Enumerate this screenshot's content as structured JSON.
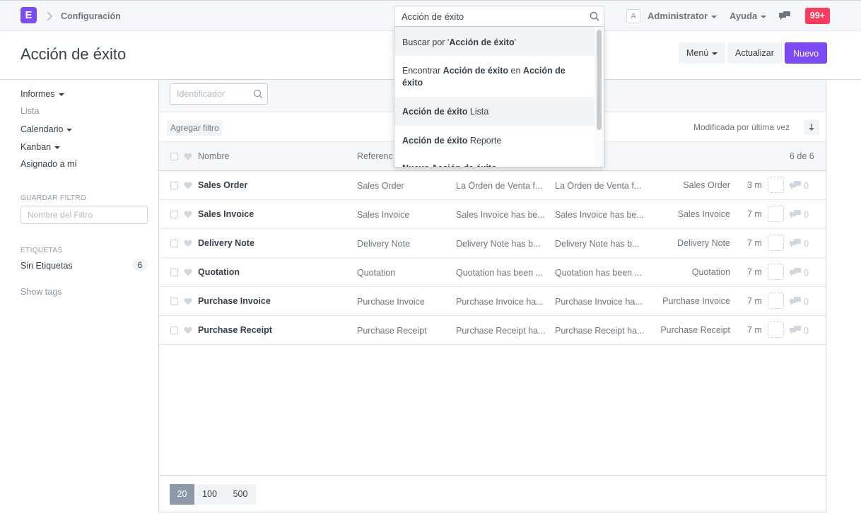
{
  "navbar": {
    "logo_letter": "E",
    "breadcrumb": "Configuración",
    "search_value": "Acción de éxito",
    "avatar_letter": "A",
    "user": "Administrator",
    "help": "Ayuda",
    "notifications": "99+"
  },
  "header": {
    "title": "Acción de éxito",
    "menu_label": "Menú",
    "refresh_label": "Actualizar",
    "new_label": "Nuevo"
  },
  "sidebar": {
    "reports": "Informes",
    "list": "Lista",
    "calendar": "Calendario",
    "kanban": "Kanban",
    "assigned": "Asignado a mí",
    "save_filter_label": "GUARDAR FILTRO",
    "filter_name_placeholder": "Nombre del Filtro",
    "tags_label": "ETIQUETAS",
    "no_tags": "Sin Etiquetas",
    "no_tags_count": "6",
    "show_tags": "Show tags"
  },
  "list": {
    "id_placeholder": "Identificador",
    "add_filter": "Agregar filtro",
    "sort_label": "Modificada por última vez",
    "col_name": "Nombre",
    "col_ref": "Referenc",
    "count": "6 de 6",
    "rows": [
      {
        "name": "Sales Order",
        "ref": "Sales Order",
        "msg1": "La Órden de Venta f...",
        "msg2": "La Órden de Venta f...",
        "doctype": "Sales Order",
        "time": "3 m",
        "comments": "0"
      },
      {
        "name": "Sales Invoice",
        "ref": "Sales Invoice",
        "msg1": "Sales Invoice has be...",
        "msg2": "Sales Invoice has be...",
        "doctype": "Sales Invoice",
        "time": "7 m",
        "comments": "0"
      },
      {
        "name": "Delivery Note",
        "ref": "Delivery Note",
        "msg1": "Delivery Note has b...",
        "msg2": "Delivery Note has b...",
        "doctype": "Delivery Note",
        "time": "7 m",
        "comments": "0"
      },
      {
        "name": "Quotation",
        "ref": "Quotation",
        "msg1": "Quotation has been ...",
        "msg2": "Quotation has been ...",
        "doctype": "Quotation",
        "time": "7 m",
        "comments": "0"
      },
      {
        "name": "Purchase Invoice",
        "ref": "Purchase Invoice",
        "msg1": "Purchase Invoice ha...",
        "msg2": "Purchase Invoice ha...",
        "doctype": "Purchase Invoice",
        "time": "7 m",
        "comments": "0"
      },
      {
        "name": "Purchase Receipt",
        "ref": "Purchase Receipt",
        "msg1": "Purchase Receipt ha...",
        "msg2": "Purchase Receipt ha...",
        "doctype": "Purchase Receipt",
        "time": "7 m",
        "comments": "0"
      }
    ],
    "page_sizes": [
      "20",
      "100",
      "500"
    ]
  },
  "dropdown": {
    "search_prefix": "Buscar por '",
    "search_term": "Acción de éxito",
    "search_suffix": "'",
    "find_prefix": "Encontrar ",
    "find_term": "Acción de éxito",
    "find_mid": " en ",
    "find_target_1": "Acción de",
    "find_target_2": "éxito",
    "list_term": "Acción de éxito",
    "list_suffix": " Lista",
    "report_term": "Acción de éxito",
    "report_suffix": " Reporte",
    "partial_item": "Nuevo Acción de éxito"
  },
  "colors": {
    "brand": "#7b4cf6",
    "notification": "#ff3b5c",
    "active_pager": "#8d99a6"
  }
}
